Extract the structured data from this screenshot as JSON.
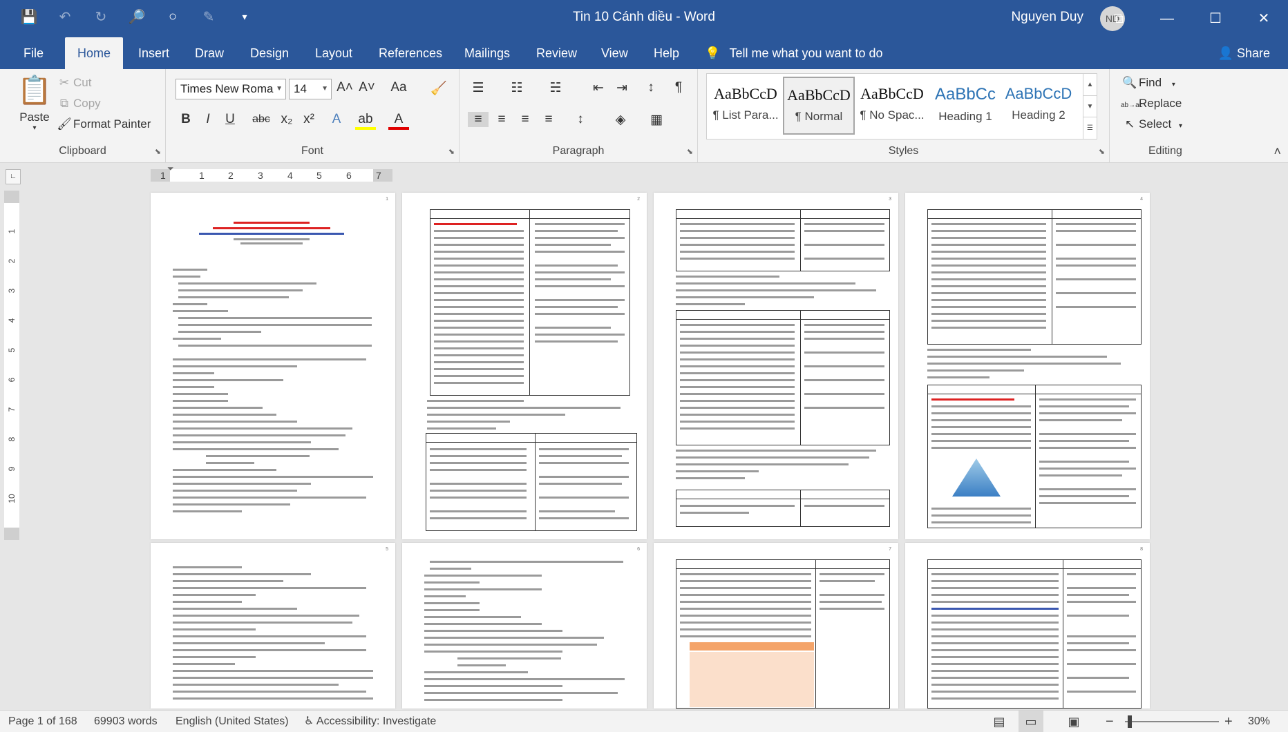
{
  "window": {
    "title": "Tin 10 Cánh diều  -  Word",
    "user_name": "Nguyen Duy",
    "user_initials": "ND"
  },
  "tabs": [
    {
      "label": "File"
    },
    {
      "label": "Home"
    },
    {
      "label": "Insert"
    },
    {
      "label": "Draw"
    },
    {
      "label": "Design"
    },
    {
      "label": "Layout"
    },
    {
      "label": "References"
    },
    {
      "label": "Mailings"
    },
    {
      "label": "Review"
    },
    {
      "label": "View"
    },
    {
      "label": "Help"
    }
  ],
  "active_tab": "Home",
  "tell_me": "Tell me what you want to do",
  "share_label": "Share",
  "clipboard": {
    "group_label": "Clipboard",
    "paste": "Paste",
    "cut": "Cut",
    "copy": "Copy",
    "format_painter": "Format Painter"
  },
  "font": {
    "group_label": "Font",
    "font_name": "Times New Roma",
    "font_size": "14"
  },
  "paragraph": {
    "group_label": "Paragraph"
  },
  "styles": {
    "group_label": "Styles",
    "items": [
      {
        "sample": "AaBbCcD",
        "name": "¶ List Para..."
      },
      {
        "sample": "AaBbCcD",
        "name": "¶ Normal"
      },
      {
        "sample": "AaBbCcD",
        "name": "¶ No Spac..."
      },
      {
        "sample": "AaBbCc",
        "name": "Heading 1"
      },
      {
        "sample": "AaBbCcD",
        "name": "Heading 2"
      }
    ],
    "selected": "¶ Normal"
  },
  "editing": {
    "group_label": "Editing",
    "find": "Find",
    "replace": "Replace",
    "select": "Select"
  },
  "ruler": {
    "numbers": [
      "1",
      "1",
      "2",
      "3",
      "4",
      "5",
      "6",
      "7"
    ]
  },
  "vertical_ruler": {
    "numbers": [
      "1",
      "2",
      "3",
      "4",
      "5",
      "6",
      "7",
      "8",
      "9",
      "10"
    ]
  },
  "pages": [
    {
      "number": "1"
    },
    {
      "number": "2"
    },
    {
      "number": "3"
    },
    {
      "number": "4"
    },
    {
      "number": "5"
    },
    {
      "number": "6"
    },
    {
      "number": "7"
    },
    {
      "number": "8"
    }
  ],
  "status": {
    "page": "Page 1 of 168",
    "words": "69903 words",
    "language": "English (United States)",
    "accessibility": "Accessibility: Investigate",
    "zoom": "30%"
  },
  "icons": {
    "save": "💾",
    "undo": "↶",
    "redo": "↻",
    "search": "🔎",
    "circle": "○",
    "pen": "✎",
    "qat_more": "▾",
    "ribbon_display": "⧉",
    "minimize": "—",
    "maximize": "☐",
    "close": "✕",
    "lightbulb": "💡",
    "share": "👤",
    "paste": "📋",
    "cut": "✂",
    "copy": "⧉",
    "brush": "🖌",
    "grow": "A˄",
    "shrink": "A˅",
    "case": "Aa",
    "clear": "🧹",
    "bullets": "☰",
    "numbering": "☷",
    "multilevel": "☵",
    "outdent": "⇤",
    "indent": "⇥",
    "sort": "↕",
    "pilcrow": "¶",
    "bold": "B",
    "italic": "I",
    "underline": "U",
    "strike": "abc",
    "sub": "x₂",
    "sup": "x²",
    "effects": "A",
    "highlight": "ab",
    "color": "A",
    "align_left": "≡",
    "align_center": "≡",
    "align_right": "≡",
    "justify": "≡",
    "spacing": "↕",
    "shading": "◈",
    "borders": "▦",
    "find": "🔍",
    "replace": "ab→ac",
    "select": "↖",
    "collapse": "˄",
    "accessibility": "♿",
    "read_view": "▤",
    "print_view": "▭",
    "web_view": "▣",
    "zoom_out": "−",
    "zoom_in": "+"
  }
}
